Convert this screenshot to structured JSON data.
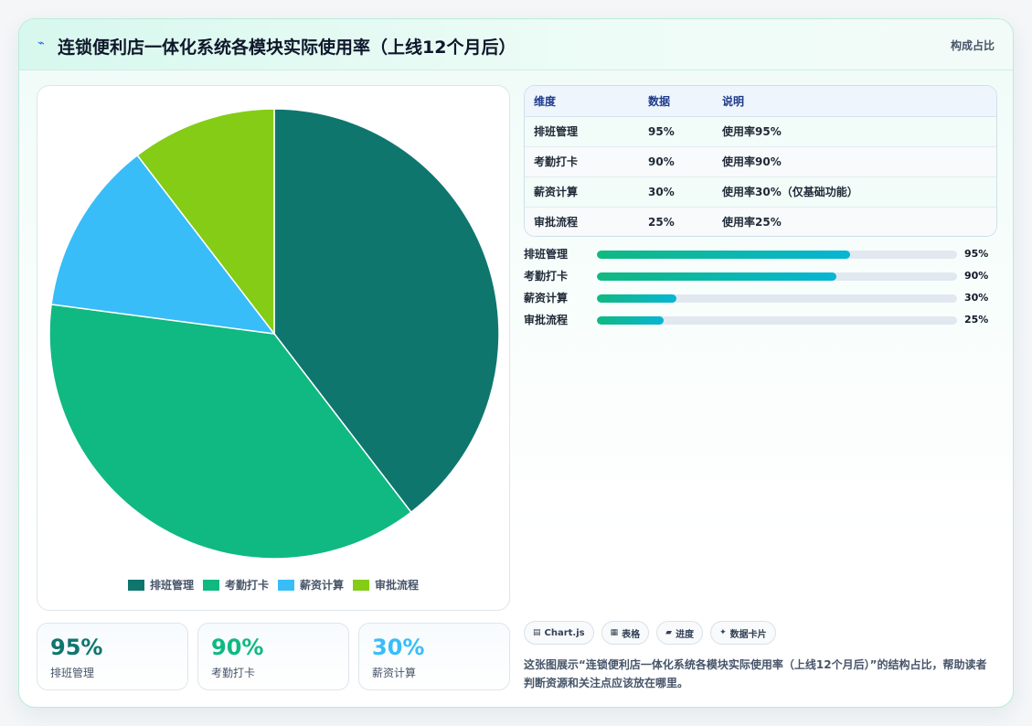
{
  "header": {
    "icon": "lightning-icon",
    "title": "连锁便利店一体化系统各模块实际使用率（上线12个月后）",
    "tag": "构成占比"
  },
  "chart_data": {
    "type": "pie",
    "categories": [
      "排班管理",
      "考勤打卡",
      "薪资计算",
      "审批流程"
    ],
    "values": [
      95,
      90,
      30,
      25
    ],
    "colors": [
      "#0f766e",
      "#10b981",
      "#38bdf8",
      "#84cc16"
    ],
    "legend_position": "bottom"
  },
  "stats": [
    {
      "value": "95%",
      "label": "排班管理",
      "color": "#0f766e"
    },
    {
      "value": "90%",
      "label": "考勤打卡",
      "color": "#10b981"
    },
    {
      "value": "30%",
      "label": "薪资计算",
      "color": "#38bdf8"
    }
  ],
  "table": {
    "headers": [
      "维度",
      "数据",
      "说明"
    ],
    "rows": [
      [
        "排班管理",
        "95%",
        "使用率95%"
      ],
      [
        "考勤打卡",
        "90%",
        "使用率90%"
      ],
      [
        "薪资计算",
        "30%",
        "使用率30%（仅基础功能）"
      ],
      [
        "审批流程",
        "25%",
        "使用率25%"
      ]
    ]
  },
  "progress": [
    {
      "label": "排班管理",
      "value": 95,
      "text": "95%"
    },
    {
      "label": "考勤打卡",
      "value": 90,
      "text": "90%"
    },
    {
      "label": "薪资计算",
      "value": 30,
      "text": "30%"
    },
    {
      "label": "审批流程",
      "value": 25,
      "text": "25%"
    }
  ],
  "tags": [
    {
      "icon": "chart-icon",
      "glyph": "▤",
      "label": "Chart.js"
    },
    {
      "icon": "table-icon",
      "glyph": "▦",
      "label": "表格"
    },
    {
      "icon": "progress-icon",
      "glyph": "▰",
      "label": "进度"
    },
    {
      "icon": "sparkle-icon",
      "glyph": "✦",
      "label": "数据卡片"
    }
  ],
  "description": "这张图展示“连锁便利店一体化系统各模块实际使用率（上线12个月后）”的结构占比，帮助读者判断资源和关注点应该放在哪里。"
}
